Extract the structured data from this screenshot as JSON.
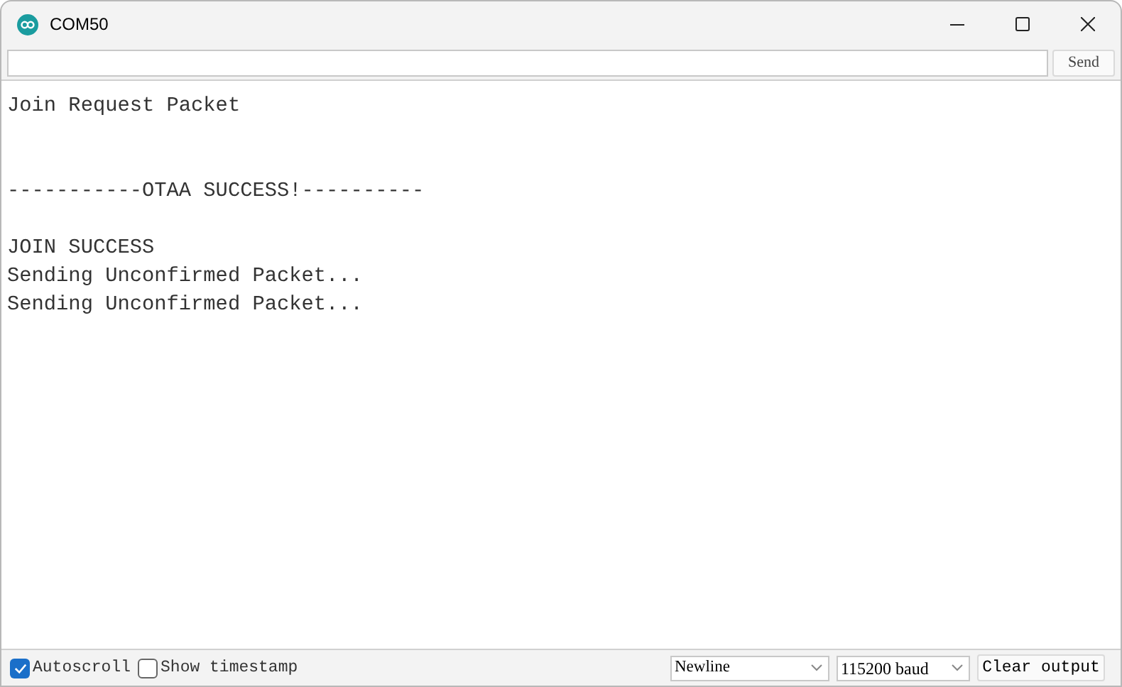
{
  "window": {
    "title": "COM50"
  },
  "send_button": "Send",
  "output_lines": [
    {
      "kind": "text",
      "text": "Join Request Packet"
    },
    {
      "kind": "blank"
    },
    {
      "kind": "blank"
    },
    {
      "kind": "text",
      "text": "-----------OTAA SUCCESS!----------"
    },
    {
      "kind": "blank"
    },
    {
      "kind": "text",
      "text": "JOIN SUCCESS"
    },
    {
      "kind": "text",
      "text": "Sending Unconfirmed Packet..."
    },
    {
      "kind": "text",
      "text": "Sending Unconfirmed Packet..."
    }
  ],
  "options": [
    {
      "label": "Autoscroll",
      "checked": true
    },
    {
      "label": "Show timestamp",
      "checked": false
    }
  ],
  "line_ending": "Newline",
  "baud_rate": "115200 baud",
  "clear_button": "Clear output"
}
